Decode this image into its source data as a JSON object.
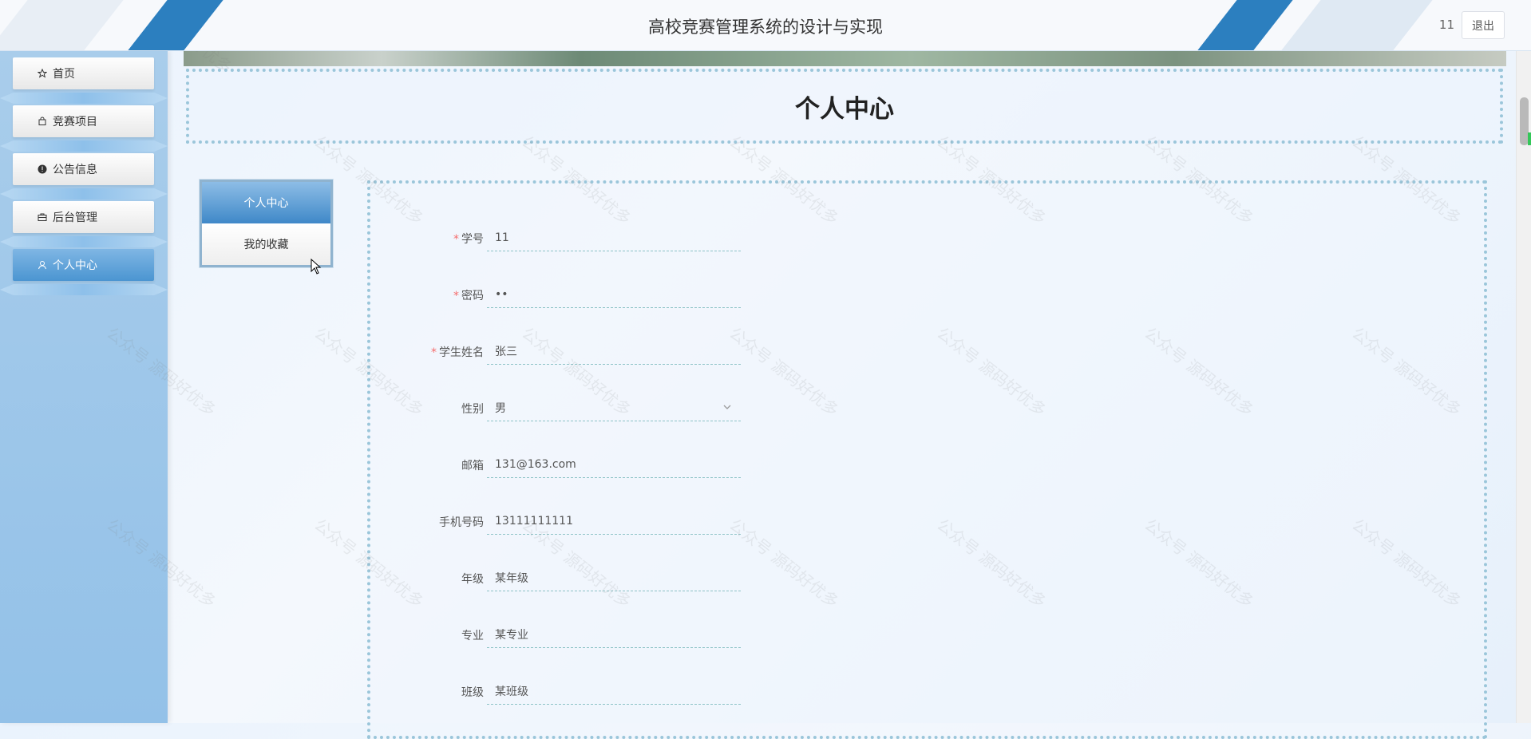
{
  "header": {
    "title": "高校竞赛管理系统的设计与实现",
    "user_id": "11",
    "logout_label": "退出"
  },
  "sidebar": {
    "items": [
      {
        "label": "首页",
        "icon": "star-icon"
      },
      {
        "label": "竞赛项目",
        "icon": "bag-icon"
      },
      {
        "label": "公告信息",
        "icon": "alert-icon"
      },
      {
        "label": "后台管理",
        "icon": "briefcase-icon"
      },
      {
        "label": "个人中心",
        "icon": "user-icon",
        "active": true
      }
    ]
  },
  "page": {
    "title": "个人中心"
  },
  "tabs": [
    {
      "label": "个人中心",
      "active": true
    },
    {
      "label": "我的收藏",
      "active": false
    }
  ],
  "form": {
    "fields": [
      {
        "label": "学号",
        "required": true,
        "value": "11"
      },
      {
        "label": "密码",
        "required": true,
        "value": "••"
      },
      {
        "label": "学生姓名",
        "required": true,
        "value": "张三"
      },
      {
        "label": "性别",
        "required": false,
        "value": "男",
        "type": "select"
      },
      {
        "label": "邮箱",
        "required": false,
        "value": "131@163.com"
      },
      {
        "label": "手机号码",
        "required": false,
        "value": "13111111111"
      },
      {
        "label": "年级",
        "required": false,
        "value": "某年级"
      },
      {
        "label": "专业",
        "required": false,
        "value": "某专业"
      },
      {
        "label": "班级",
        "required": false,
        "value": "某班级"
      }
    ]
  },
  "watermark": "公众号 源码好优多",
  "colors": {
    "accent": "#4b95d1",
    "sidebar_bg": "#a9cdeb",
    "dotted_border": "#9bc6da",
    "required": "#f56c6c"
  }
}
